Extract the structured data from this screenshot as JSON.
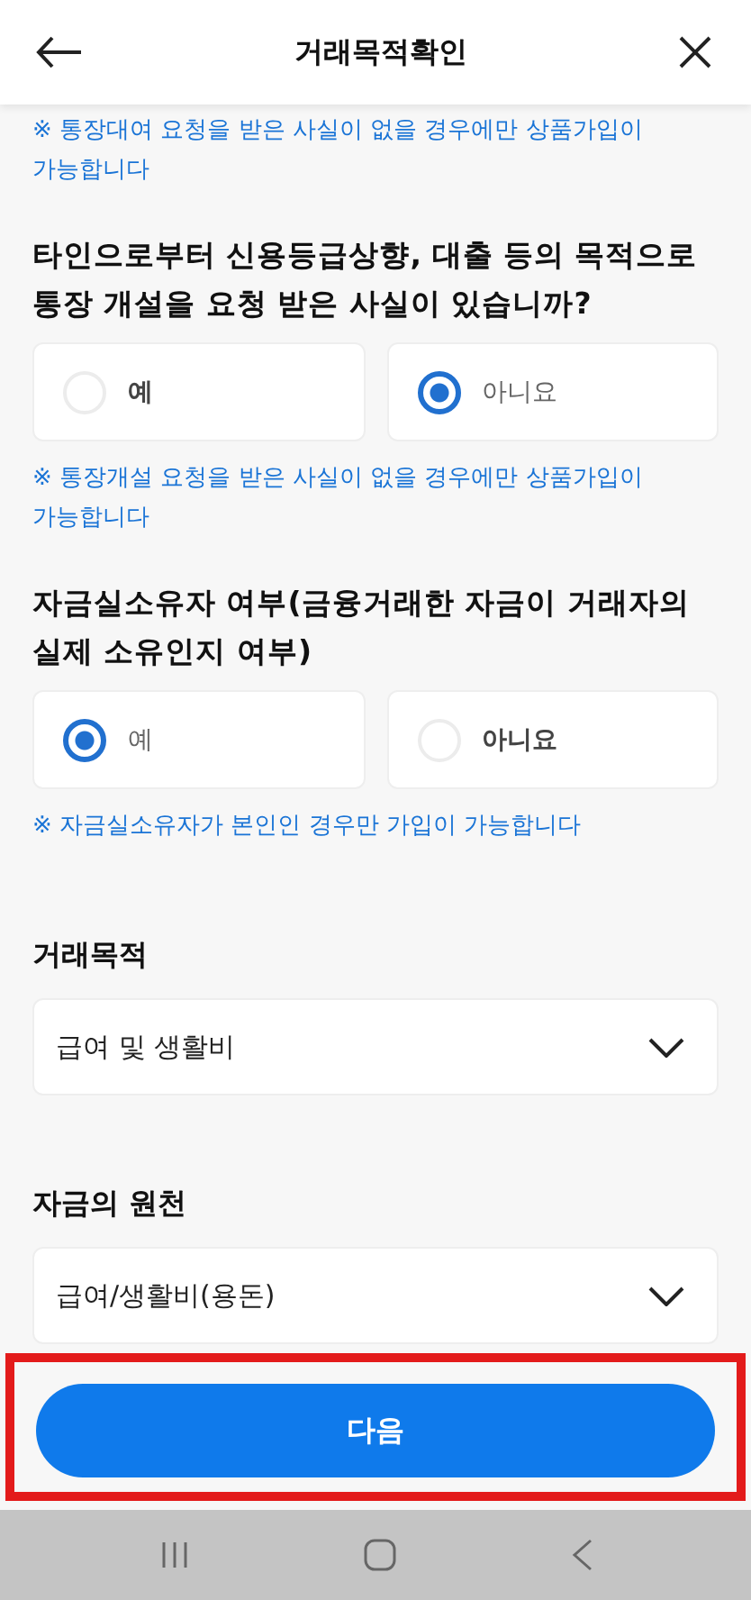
{
  "header": {
    "title": "거래목적확인"
  },
  "top_note": "※ 통장대여 요청을 받은 사실이 없을 경우에만 상품가입이 가능합니다",
  "questions": [
    {
      "question": "타인으로부터 신용등급상향, 대출 등의 목적으로 통장 개설을 요청 받은 사실이 있습니까?",
      "options": [
        {
          "label": "예",
          "selected": false
        },
        {
          "label": "아니요",
          "selected": true
        }
      ],
      "note": "※ 통장개설 요청을 받은 사실이 없을 경우에만 상품가입이 가능합니다"
    },
    {
      "question": "자금실소유자 여부(금융거래한 자금이 거래자의 실제 소유인지 여부)",
      "options": [
        {
          "label": "예",
          "selected": true
        },
        {
          "label": "아니요",
          "selected": false
        }
      ],
      "note": "※ 자금실소유자가 본인인 경우만 가입이 가능합니다"
    }
  ],
  "selects": [
    {
      "label": "거래목적",
      "value": "급여 및 생활비"
    },
    {
      "label": "자금의 원천",
      "value": "급여/생활비(용돈)"
    }
  ],
  "next_button": "다음"
}
